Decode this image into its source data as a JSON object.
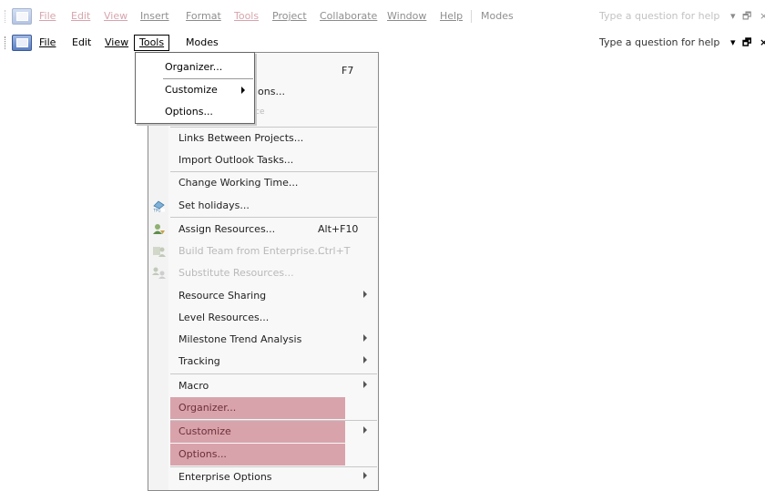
{
  "menubar_faded": {
    "items": [
      "File",
      "Edit",
      "View",
      "Insert",
      "Format",
      "Tools",
      "Project",
      "Collaborate",
      "Window",
      "Help",
      "Modes"
    ],
    "help_placeholder": "Type a question for help",
    "controls": [
      "▾",
      "🗗",
      "×"
    ]
  },
  "menubar": {
    "items": [
      "File",
      "Edit",
      "View",
      "Tools",
      "Modes"
    ],
    "help_placeholder": "Type a question for help",
    "controls": [
      "▾",
      "🗗",
      "×"
    ]
  },
  "tools_menu": {
    "shortcut_top": "F7",
    "partial_behind": [
      "ions...",
      "ce"
    ],
    "items": [
      {
        "label": "Links Between Projects..."
      },
      {
        "label": "Import Outlook Tasks..."
      },
      {
        "label": "Change Working Time..."
      },
      {
        "label": "Set holidays...",
        "icon": "tpg-icon"
      },
      {
        "label": "Assign Resources...",
        "shortcut": "Alt+F10",
        "icon": "assign-resources-icon"
      },
      {
        "label": "Build Team from Enterprise...",
        "shortcut": "Ctrl+T",
        "disabled": true,
        "icon": "build-team-icon"
      },
      {
        "label": "Substitute Resources...",
        "disabled": true,
        "icon": "substitute-resources-icon"
      },
      {
        "label": "Resource Sharing",
        "submenu": true
      },
      {
        "label": "Level Resources..."
      },
      {
        "label": "Milestone Trend Analysis",
        "submenu": true
      },
      {
        "label": "Tracking",
        "submenu": true
      },
      {
        "label": "Macro",
        "submenu": true
      },
      {
        "label": "Organizer...",
        "highlighted": true
      },
      {
        "label": "Customize",
        "submenu": true,
        "highlighted": true
      },
      {
        "label": "Options...",
        "highlighted": true
      },
      {
        "label": "Enterprise Options",
        "submenu": true
      }
    ]
  },
  "tools_submenu": {
    "items": [
      "Organizer...",
      "Customize",
      "Options..."
    ]
  },
  "colors": {
    "highlight": "#d9a3ac",
    "accent_red": "#a7364a"
  }
}
